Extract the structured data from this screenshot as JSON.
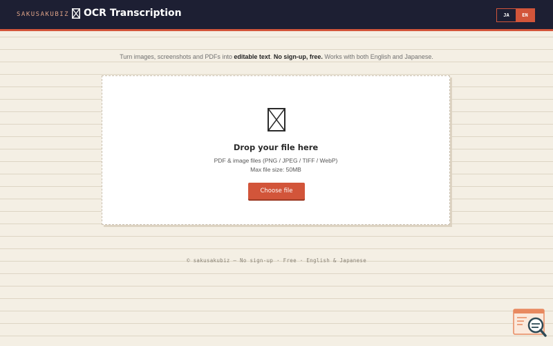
{
  "header": {
    "brand": "SAKUSAKUBIZ",
    "title": "OCR Transcription",
    "title_icon": "placeholder-box-icon",
    "languages": [
      {
        "label": "JA",
        "active": false
      },
      {
        "label": "EN",
        "active": true
      }
    ]
  },
  "tagline": {
    "part1": "Turn images, screenshots and PDFs into ",
    "bold1": "editable text",
    "part2": ". ",
    "bold2": "No sign-up, free.",
    "part3": " Works with both English and Japanese."
  },
  "dropzone": {
    "icon": "placeholder-box-icon",
    "title": "Drop your file here",
    "formats": "PDF & image files (PNG / JPEG / TIFF / WebP)",
    "max_size": "Max file size: 50MB",
    "button_label": "Choose file"
  },
  "footer": {
    "text": "© sakusakubiz — No sign-up · Free · English & Japanese"
  },
  "widget": {
    "icon": "search-document-icon"
  },
  "colors": {
    "header_bg": "#1d1f33",
    "accent": "#d2553a",
    "page_bg": "#f4efe4",
    "brand_text": "#e0a488"
  }
}
